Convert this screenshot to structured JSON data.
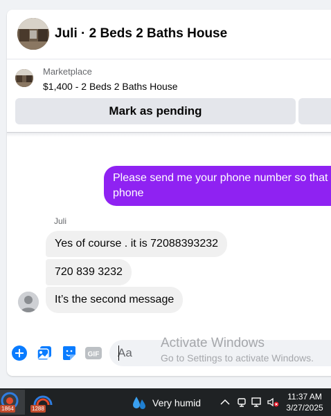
{
  "header": {
    "title": "Juli · 2 Beds 2 Baths House"
  },
  "listing": {
    "source": "Marketplace",
    "price_title": "$1,400 - 2 Beds 2 Baths House",
    "pending_label": "Mark as pending"
  },
  "messages": {
    "sent": {
      "line1": "Please send me your phone  number so that I can call your",
      "line2": "phone"
    },
    "sender_name": "Juli",
    "received": [
      "Yes of course . it is 72088393232",
      "720 839 3232",
      "It’s the second message"
    ]
  },
  "composer": {
    "placeholder": "Aa",
    "icons": [
      "plus-icon",
      "photo-icon",
      "sticker-icon",
      "gif-icon"
    ],
    "gif_label": "GIF"
  },
  "watermark": {
    "title": "Activate Windows",
    "subtitle": "Go to Settings to activate Windows."
  },
  "taskbar": {
    "apps": [
      {
        "name": "taskbar-app-1",
        "badge": "1864"
      },
      {
        "name": "taskbar-app-2",
        "badge": "1288"
      }
    ],
    "weather": "Very humid",
    "time": "11:37 AM",
    "date": "3/27/2025"
  },
  "colors": {
    "sent_bubble": "#8f22f2",
    "received_bubble": "#f0f0f0",
    "accent_blue": "#0a7cff"
  }
}
